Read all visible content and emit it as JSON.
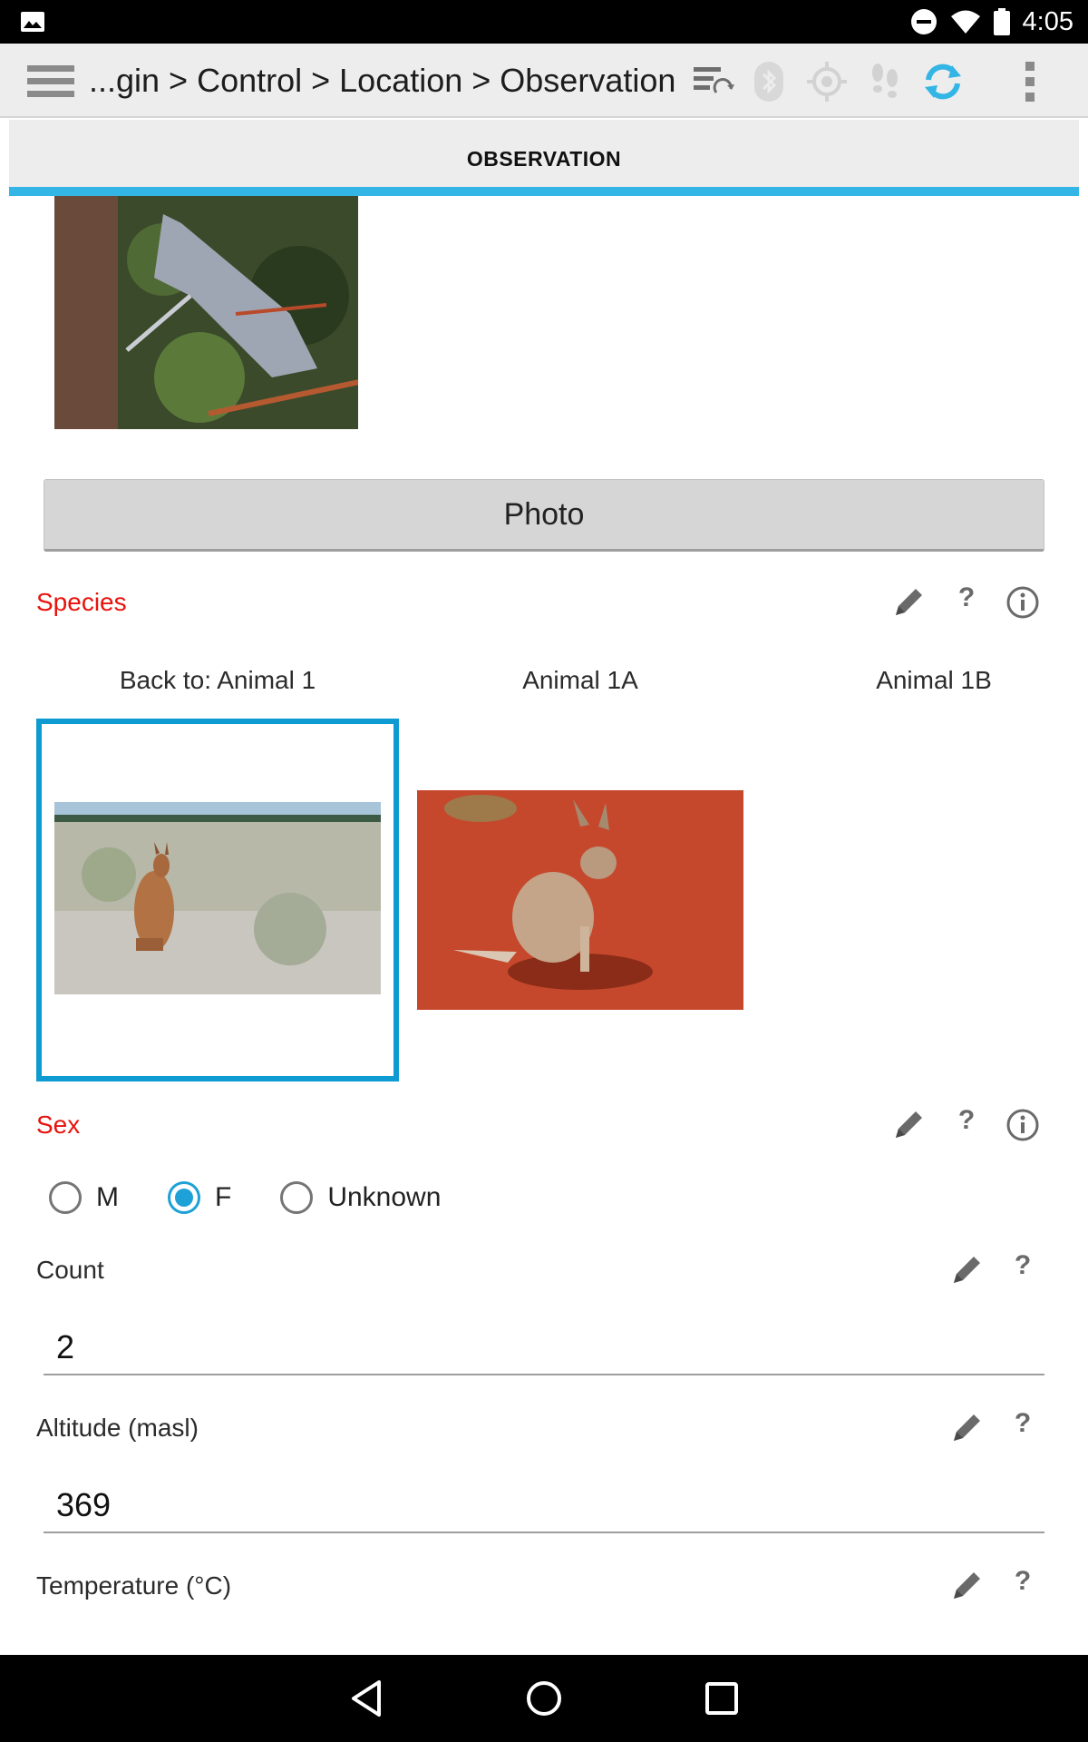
{
  "status_bar": {
    "time": "4:05",
    "icons": [
      "image-notification-icon",
      "do-not-disturb-icon",
      "wifi-icon",
      "battery-icon"
    ]
  },
  "toolbar": {
    "breadcrumb": "...gin > Control > Location > Observation",
    "icons": [
      "menu-icon",
      "sync-list-icon",
      "bluetooth-icon",
      "gps-icon",
      "tracking-footsteps-icon",
      "sync-icon",
      "overflow-menu-icon"
    ],
    "accent": "#33b5e5"
  },
  "tab": {
    "label": "OBSERVATION"
  },
  "photo": {
    "button_label": "Photo"
  },
  "species": {
    "label": "Species",
    "tabs": [
      "Back to: Animal 1",
      "Animal 1A",
      "Animal 1B"
    ],
    "selected_index": 0
  },
  "sex": {
    "label": "Sex",
    "options": [
      "M",
      "F",
      "Unknown"
    ],
    "selected": "F"
  },
  "count": {
    "label": "Count",
    "value": "2"
  },
  "altitude": {
    "label": "Altitude (masl)",
    "value": "369"
  },
  "temperature": {
    "label": "Temperature (°C)"
  },
  "colors": {
    "required_label": "#e8120c",
    "selection_border": "#0e9bd1",
    "radio_checked": "#1da1d6"
  }
}
